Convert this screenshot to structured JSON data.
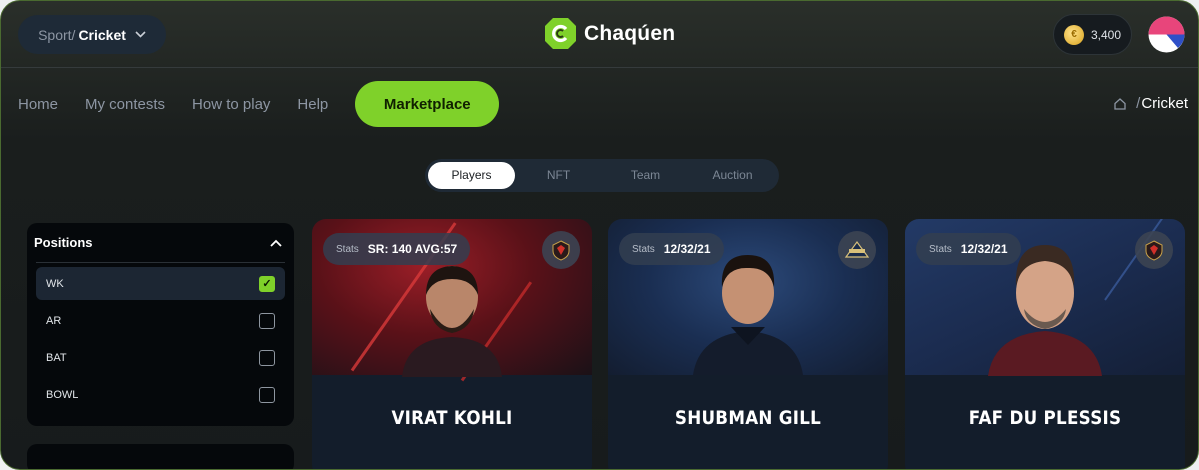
{
  "header": {
    "sport_prefix": "Sport/",
    "sport_value": "Cricket",
    "brand_name": "Chaqúen",
    "coins": "3,400"
  },
  "nav": {
    "items": [
      "Home",
      "My contests",
      "How to play",
      "Help"
    ],
    "active": "Marketplace"
  },
  "breadcrumb": {
    "sep": "/",
    "current": "Cricket"
  },
  "tabs": [
    "Players",
    "NFT",
    "Team",
    "Auction"
  ],
  "filters": {
    "title": "Positions",
    "options": [
      {
        "label": "WK",
        "checked": true
      },
      {
        "label": "AR",
        "checked": false
      },
      {
        "label": "BAT",
        "checked": false
      },
      {
        "label": "BOWL",
        "checked": false
      }
    ]
  },
  "cards": [
    {
      "name": "VIRAT KOHLI",
      "stats_label": "Stats",
      "stats_value": "SR: 140 AVG:57",
      "team_icon": "rcb-crest-icon"
    },
    {
      "name": "SHUBMAN GILL",
      "stats_label": "Stats",
      "stats_value": "12/32/21",
      "team_icon": "titans-crest-icon"
    },
    {
      "name": "FAF DU PLESSIS",
      "stats_label": "Stats",
      "stats_value": "12/32/21",
      "team_icon": "rcb-crest-icon"
    }
  ],
  "colors": {
    "accent": "#7fd12a",
    "background": "#171b1c",
    "card": "#131d2b"
  }
}
